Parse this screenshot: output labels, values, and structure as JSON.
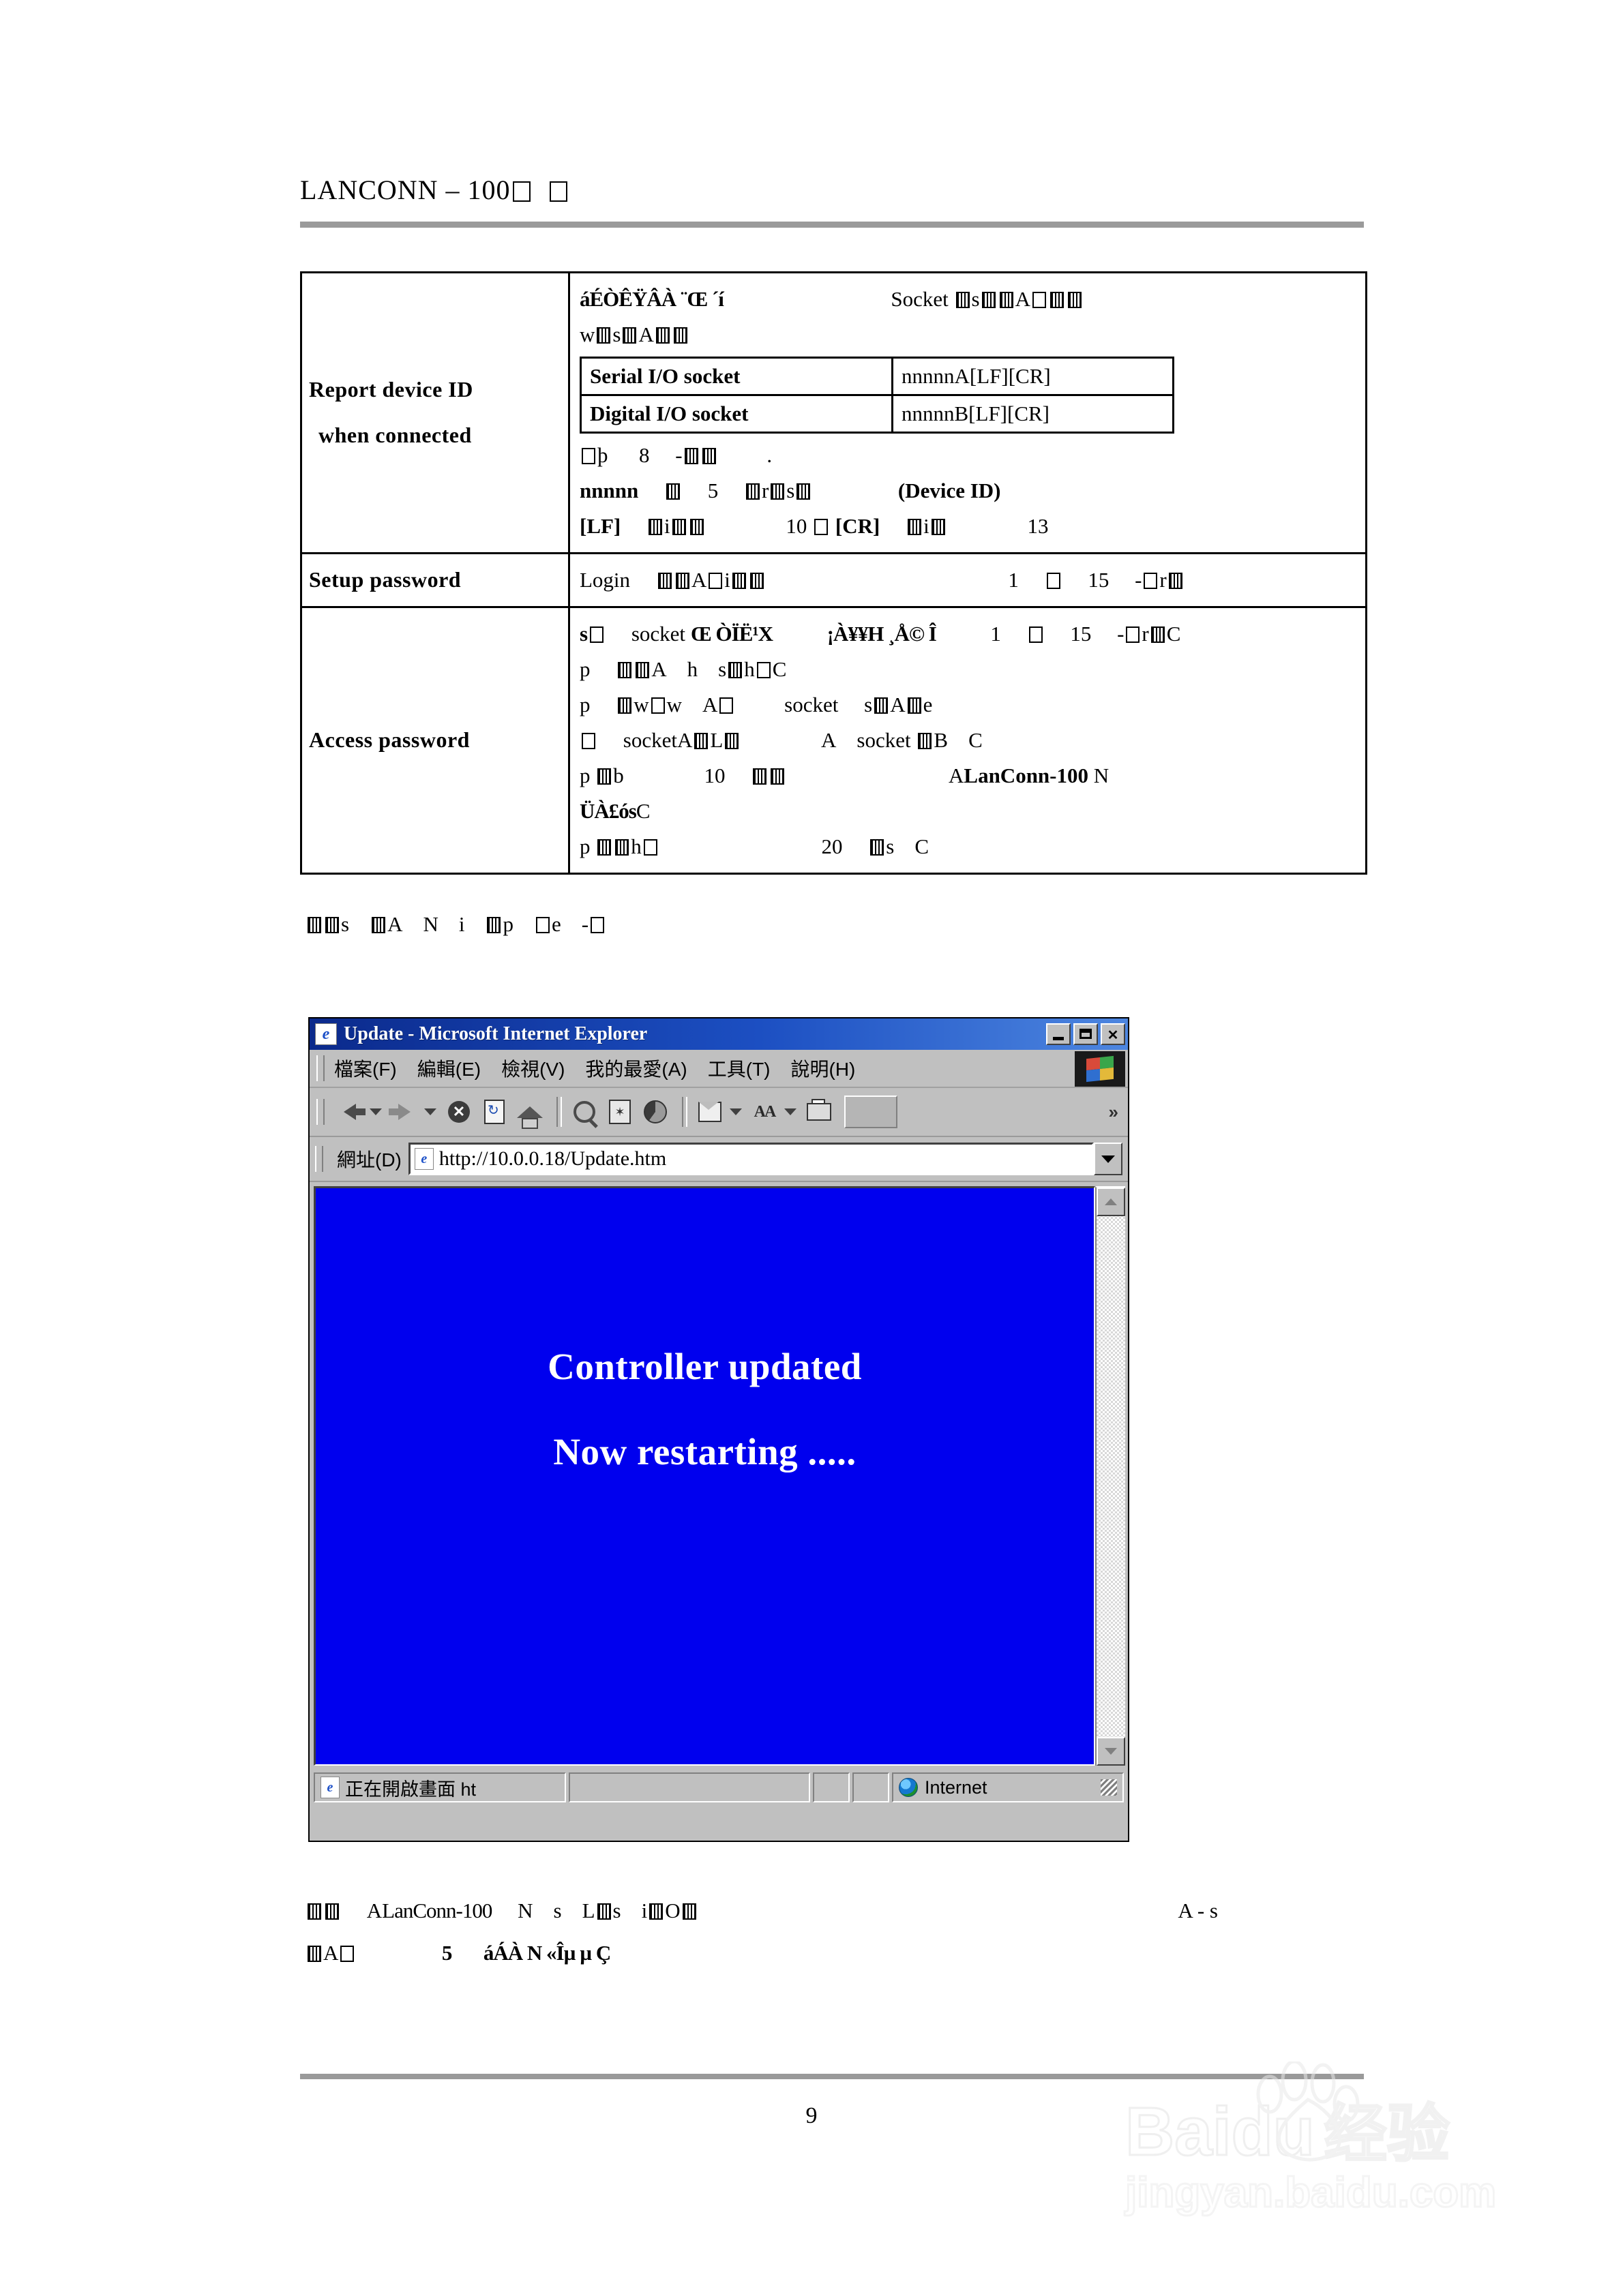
{
  "page": {
    "header_title": "LANCONN – 100",
    "header_title_suffix_boxes": 2,
    "page_number": "9"
  },
  "spec_table": {
    "rows": [
      {
        "label_line1": "Report device ID",
        "label_line2": "when connected",
        "intro_line1_left": "áÉÒÊŸÂÀ ¨Œ ´í",
        "intro_line1_right": "Socket",
        "intro_line2": "w",
        "nested": {
          "rows": [
            {
              "label": "Serial I/O socket",
              "value": "nnnnnA[LF][CR]"
            },
            {
              "label": "Digital I/O socket",
              "value": "nnnnnB[LF][CR]"
            }
          ]
        },
        "note_line1_prefix": "þ",
        "note_line1_number": "8",
        "note_line2_token": "nnnnn",
        "note_line2_number": "5",
        "note_line2_tail": "(Device ID)",
        "note_line3_lf": "[LF]",
        "note_line3_lf_value": "10",
        "note_line3_cr": "[CR]",
        "note_line3_cr_value": "13"
      },
      {
        "label_line1": "Setup password",
        "body_prefix": "Login",
        "range_from": "1",
        "range_to": "15"
      },
      {
        "label_line1": "Access password",
        "line1_prefix": "s",
        "line1_socket": "socket",
        "line1_garble_a": "Œ ÒÏË¹X",
        "line1_garble_b": "¡À¥¥H ¸Å© Î",
        "line1_range_from": "1",
        "line1_range_to": "15",
        "line2_prefix": "p",
        "line3_prefix": "p",
        "line3_socket": "socket",
        "line4_socket_a": "socket",
        "line4_socket_b": "socket",
        "line5_prefix": "p",
        "line5_number": "10",
        "line5_product": "LanConn-100",
        "line6_garble": "ÜÀ£ós",
        "line7_prefix": "p",
        "line7_number": "20"
      }
    ]
  },
  "caption_above": "s A N i p e -",
  "browser": {
    "title": "Update - Microsoft Internet Explorer",
    "window_buttons": {
      "minimize": "_",
      "maximize": "□",
      "close": "X"
    },
    "menu_items": [
      "檔案(F)",
      "編輯(E)",
      "檢視(V)",
      "我的最愛(A)",
      "工具(T)",
      "說明(H)"
    ],
    "toolbar_icons": [
      "back-icon",
      "back-dropdown-icon",
      "forward-icon",
      "forward-dropdown-icon",
      "stop-icon",
      "refresh-icon",
      "home-icon",
      "search-icon",
      "favorites-icon",
      "history-icon",
      "mail-icon",
      "mail-dropdown-icon",
      "font-size-icon",
      "font-size-dropdown-icon",
      "print-icon",
      "edit-icon"
    ],
    "toolbar_overflow": "»",
    "address_label": "網址(D)",
    "address_value": "http://10.0.0.18/Update.htm",
    "content": {
      "background_color": "#0000EE",
      "text_color": "#FFFFFF",
      "line1": "Controller updated",
      "line2": "Now restarting ....."
    },
    "status_left": "正在開啟畫面 ht",
    "status_zone": "Internet"
  },
  "caption_below": {
    "line1_product": "LanConn-100",
    "line1_prefix": "A L n",
    "line1_mid": "N s L s i O",
    "line1_tail": "A - s",
    "line2_prefix": "A",
    "line2_number": "5",
    "line2_garble": "áÁÀ N «Îµ µ Ç"
  },
  "watermark": {
    "brand": "Baidu",
    "brand_cn": "经验",
    "url": "jingyan.baidu.com"
  },
  "colors": {
    "rule": "#9A9A9A",
    "titlebar_start": "#0B2A8C",
    "titlebar_end": "#4D86E0",
    "chrome": "#C0C0C0",
    "page_blue": "#0000EE"
  }
}
